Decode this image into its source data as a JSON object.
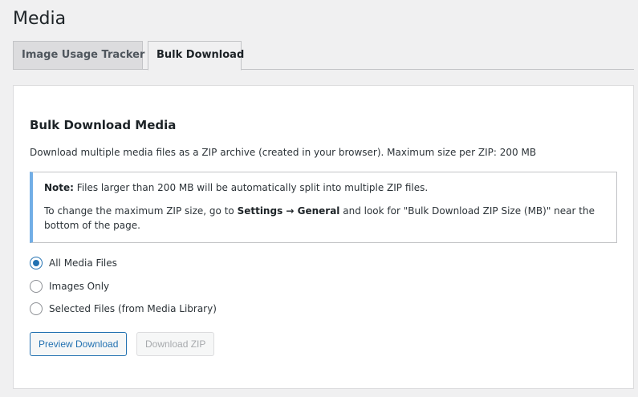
{
  "page": {
    "title": "Media"
  },
  "tabs": [
    {
      "label": "Image Usage Tracker",
      "active": false
    },
    {
      "label": "Bulk Download",
      "active": true
    }
  ],
  "panel": {
    "heading": "Bulk Download Media",
    "description": "Download multiple media files as a ZIP archive (created in your browser). Maximum size per ZIP: 200 MB",
    "notice": {
      "note_label": "Note:",
      "note_text": " Files larger than 200 MB will be automatically split into multiple ZIP files.",
      "settings_prefix": "To change the maximum ZIP size, go to ",
      "settings_path": "Settings → General",
      "settings_suffix": " and look for \"Bulk Download ZIP Size (MB)\" near the bottom of the page."
    },
    "options": [
      {
        "label": "All Media Files",
        "checked": true
      },
      {
        "label": "Images Only",
        "checked": false
      },
      {
        "label": "Selected Files (from Media Library)",
        "checked": false
      }
    ],
    "buttons": {
      "preview_label": "Preview Download",
      "download_label": "Download ZIP"
    }
  },
  "colors": {
    "accent": "#2271b1",
    "notice_border": "#72aee6",
    "background": "#f0f0f1"
  }
}
